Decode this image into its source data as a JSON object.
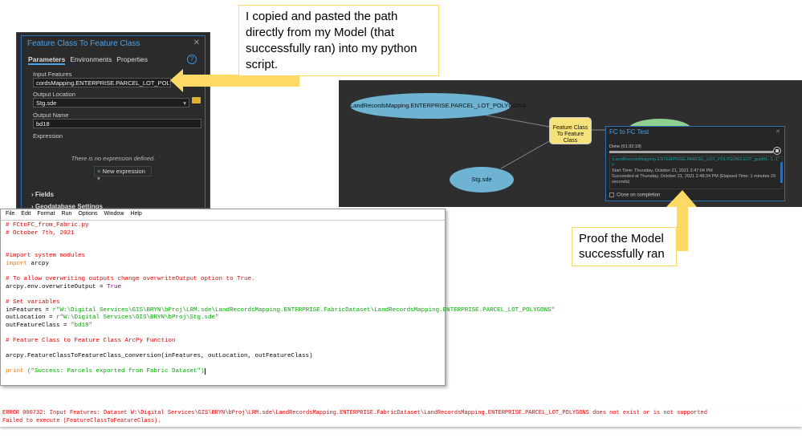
{
  "tool_panel": {
    "title": "Feature Class To Feature Class",
    "tabs": [
      "Parameters",
      "Environments",
      "Properties"
    ],
    "input_features_label": "Input Features",
    "input_features_value": "cordsMapping.ENTERPRISE.PARCEL_LOT_POLYGONS",
    "output_location_label": "Output Location",
    "output_location_value": "Stg.sde",
    "output_name_label": "Output Name",
    "output_name_value": "bd18",
    "expression_label": "Expression",
    "no_expression": "There is no expression defined.",
    "new_expression": "New expression",
    "sections": [
      "Fields",
      "Geodatabase Settings"
    ]
  },
  "editor": {
    "menu": [
      "File",
      "Edit",
      "Format",
      "Run",
      "Options",
      "Window",
      "Help"
    ],
    "code": {
      "l1": "# FCtoFC_from_Fabric.py",
      "l2": "# October 7th, 2021",
      "l3": "#import system modules",
      "l4k": "import",
      "l4": " arcpy",
      "l5": "# To allow overwriting outputs change overwriteOutput option to True.",
      "l6": "arcpy.env.overwriteOutput = ",
      "l6t": "True",
      "l7": "# Set variables",
      "l8": "inFeatures = ",
      "l8s": "r\"W:\\Digital Services\\GIS\\BRYN\\bProj\\LRM.sde\\LandRecordsMapping.ENTERPRISE.FabricDataset\\LandRecordsMapping.ENTERPRISE.PARCEL_LOT_POLYGONS\"",
      "l9": "outLocation = ",
      "l9s": "r\"W:\\Digital Services\\GIS\\BRYN\\bProj\\Stg.sde\"",
      "l10": "outFeatureClass = ",
      "l10s": "\"bd18\"",
      "l11": "# Feature Class to Feature Class ArcPy Function",
      "l12": "arcpy.FeatureClassToFeatureClass_conversion(inFeatures, outLocation, outFeatureClass)",
      "l13k": "print",
      "l13s": " (\"Success: Parcels exported from Fabric Dataset\")"
    }
  },
  "model": {
    "input_node": "LandRecordsMapping.ENTERPRISE.PARCEL_LOT_POLYGONS",
    "tool_node": "Feature Class To Feature Class",
    "location_node": "Stg.sde",
    "dialog": {
      "title": "FC to FC Test",
      "status": "Done (01:32:19)",
      "progress_percent": 100,
      "log_line1": "\\LandRecordsMapping.ENTERPRISE.PARCEL_LOT_POLYGONS,EXT_guid01,-1,-1\" #",
      "log_line2": "Start Time: Thursday, October 21, 2021 2:47:04 PM",
      "log_line3": "Succeeded at Thursday, October 21, 2021 2:48:34 PM (Elapsed Time: 1 minutes 29 seconds)",
      "close_on_completion": "Close on completion"
    },
    "colors": {
      "data_node": "#6fb3d2",
      "tool_node": "#f5e27a"
    }
  },
  "callouts": {
    "top": "I copied and pasted the path directly from my Model (that successfully ran) into my python script.",
    "bottom": "Proof the Model successfully ran",
    "color": "#ffd966"
  },
  "error": {
    "line1": "ERROR 000732: Input Features: Dataset W:\\Digital Services\\GIS\\BRYN\\bProj\\LRM.sde\\LandRecordsMapping.ENTERPRISE.FabricDataset\\LandRecordsMapping.ENTERPRISE.PARCEL_LOT_POLYGONS does not exist or is not supported",
    "line2": "Failed to execute (FeatureClassToFeatureClass)."
  }
}
